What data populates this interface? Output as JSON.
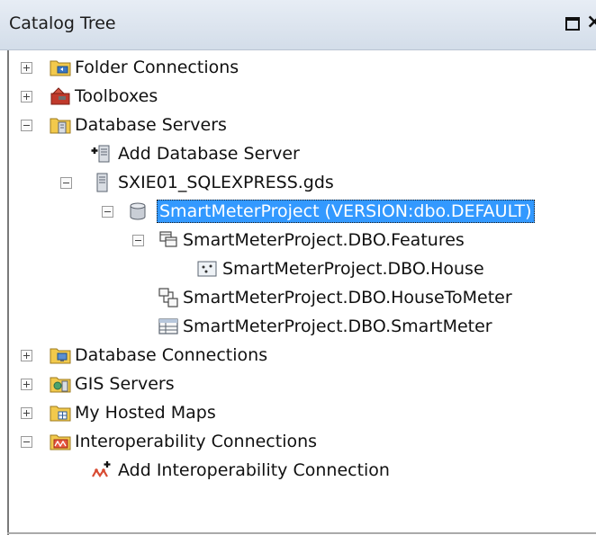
{
  "window": {
    "title": "Catalog Tree",
    "maximize_icon": "maximize-icon",
    "close_glyph": "×"
  },
  "tree": {
    "folder_connections": "Folder Connections",
    "toolboxes": "Toolboxes",
    "database_servers": "Database Servers",
    "add_database_server": "Add Database Server",
    "server_gds": "SXIE01_SQLEXPRESS.gds",
    "smart_meter_project": "SmartMeterProject (VERSION:dbo.DEFAULT)",
    "features_dataset": "SmartMeterProject.DBO.Features",
    "house_feature_class": "SmartMeterProject.DBO.House",
    "house_to_meter": "SmartMeterProject.DBO.HouseToMeter",
    "smart_meter_table": "SmartMeterProject.DBO.SmartMeter",
    "database_connections": "Database Connections",
    "gis_servers": "GIS Servers",
    "my_hosted_maps": "My Hosted Maps",
    "interoperability_connections": "Interoperability Connections",
    "add_interoperability_connection": "Add Interoperability Connection"
  },
  "colors": {
    "selection": "#3399ff",
    "folder_yellow": "#f2c94c",
    "title_bar": "#dde5ef"
  }
}
